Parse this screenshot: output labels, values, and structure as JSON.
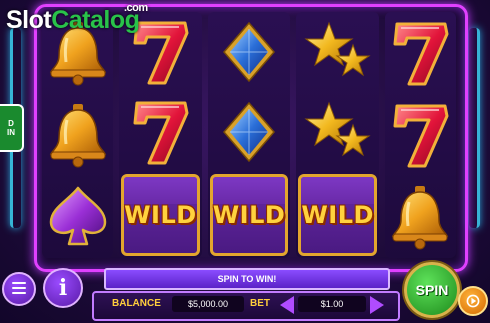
{
  "watermark": {
    "part1": "Slot",
    "part2": "Catalog",
    "suffix": ".com"
  },
  "side_tab": {
    "label": "D\nIN"
  },
  "reels": [
    [
      "bell",
      "bell",
      "spade"
    ],
    [
      "seven",
      "seven",
      "wild"
    ],
    [
      "diamond",
      "diamond",
      "wild"
    ],
    [
      "stars",
      "stars",
      "wild"
    ],
    [
      "seven",
      "seven",
      "bell"
    ]
  ],
  "wild_label": "WILD",
  "message": "SPIN TO WIN!",
  "balance": {
    "label": "BALANCE",
    "value": "$5,000.00"
  },
  "bet": {
    "label": "BET",
    "value": "$1.00"
  },
  "spin_button": {
    "label": "SPIN"
  },
  "info_button": {
    "label": "i"
  },
  "icons": {
    "menu": "menu-icon",
    "info": "info-icon",
    "autoplay": "autoplay-icon",
    "bet_down": "chevron-left-icon",
    "bet_up": "chevron-right-icon"
  },
  "colors": {
    "neon_frame": "#e040ff",
    "gold": "#ffcf3c",
    "spin_green": "#2fae2a",
    "panel_purple": "#5b22c7"
  }
}
